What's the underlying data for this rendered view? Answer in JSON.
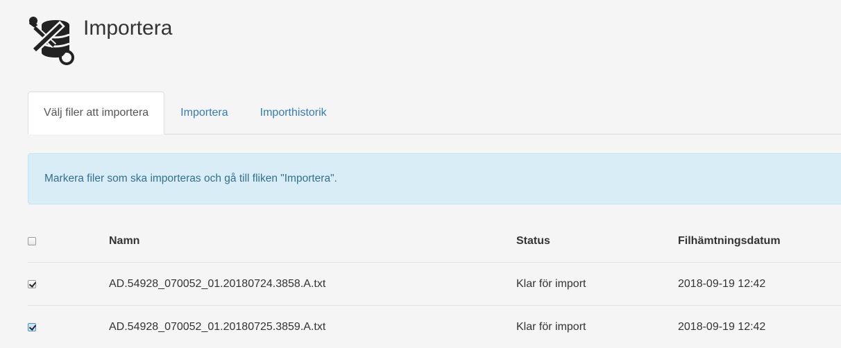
{
  "header": {
    "title": "Importera",
    "icon": "tools-database-icon"
  },
  "tabs": [
    {
      "label": "Välj filer att importera",
      "active": true
    },
    {
      "label": "Importera",
      "active": false
    },
    {
      "label": "Importhistorik",
      "active": false
    }
  ],
  "alert": {
    "text": "Markera filer som ska importeras och gå till fliken \"Importera\"."
  },
  "table": {
    "columns": {
      "name": "Namn",
      "status": "Status",
      "date": "Filhämtningsdatum"
    },
    "select_all_checked": false,
    "rows": [
      {
        "checked": true,
        "name": "AD.54928_070052_01.20180724.3858.A.txt",
        "status": "Klar för import",
        "date": "2018-09-19 12:42"
      },
      {
        "checked": true,
        "focused": true,
        "name": "AD.54928_070052_01.20180725.3859.A.txt",
        "status": "Klar för import",
        "date": "2018-09-19 12:42"
      }
    ]
  },
  "colors": {
    "link": "#337ab7",
    "alert_bg": "#d9edf7",
    "alert_text": "#31708f",
    "page_bg": "#f5f5f5"
  }
}
